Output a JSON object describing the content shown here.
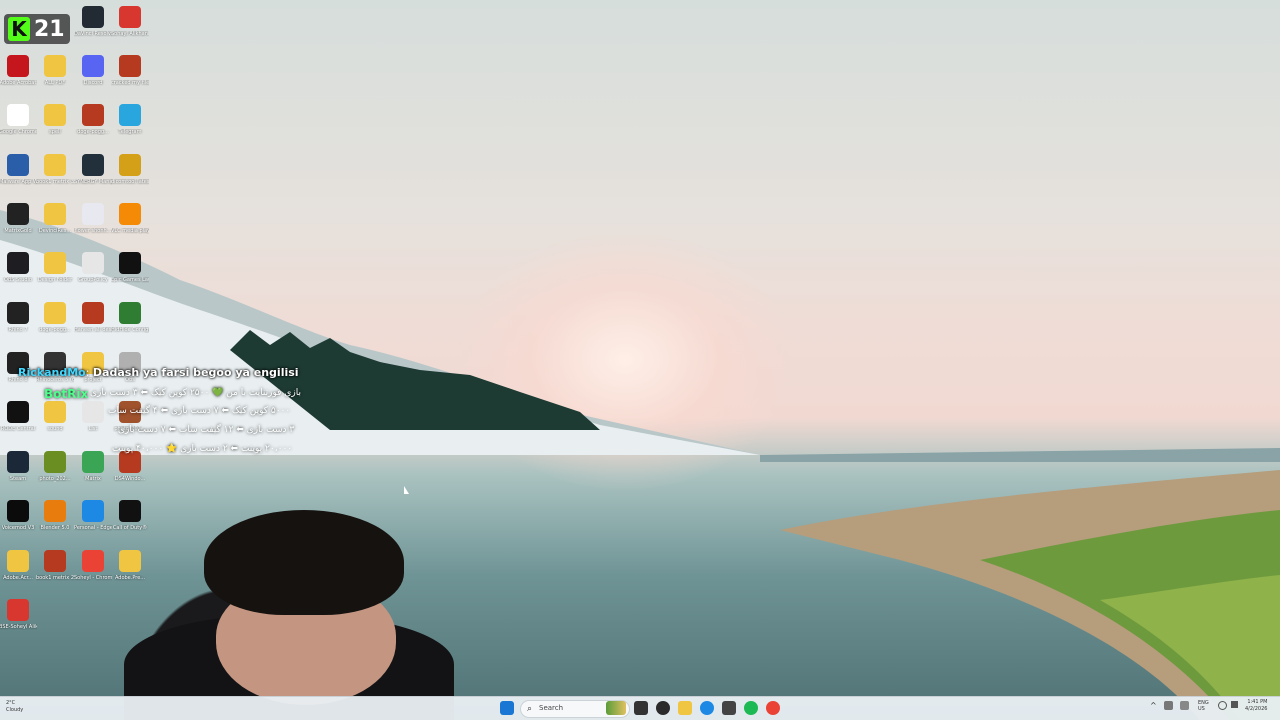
{
  "overlay": {
    "kick_count": "21"
  },
  "chat": {
    "user": "RickandMo",
    "message": "Dadash ya farsi begoo ya engilisi",
    "bot": "BotRix",
    "line1": "بازی فورتنایت با من 💚 ۲۵۰۰ کوین کیک ⬅ ۳ دست بازی",
    "line2": "۵۰۰۰ کوین کیک ⬅ ۷ دست بازی ⬅ ۴ گیفت ساب",
    "line3": "۳ دست بازی ⬅ ۱۲ گیفت ساب ⬅ ۷ دست بازی",
    "line4": "۲۰،۰۰۰ پوینت ⬅ ۲ دست بازی ⭐ ۴۰،۰۰۰ پوینت"
  },
  "desktop_icons": [
    {
      "label": "DaVinci Resolve",
      "color": "#222a33"
    },
    {
      "label": "Sohayl Alikhani (1)...",
      "color": "#d8372f"
    },
    {
      "label": "Adobe Acrobat",
      "color": "#c4161c"
    },
    {
      "label": "ALL PDF",
      "color": "#f0c542"
    },
    {
      "label": "Discord",
      "color": "#5865f2"
    },
    {
      "label": "cracked my files",
      "color": "#b53a1f"
    },
    {
      "label": "Google Chrome",
      "color": "#ffffff"
    },
    {
      "label": "spell",
      "color": "#f0c542"
    },
    {
      "label": "doge-pogg...",
      "color": "#b53a1f"
    },
    {
      "label": "Telegram",
      "color": "#2aa6de"
    },
    {
      "label": "Malware App Windows P...",
      "color": "#2a5ea8"
    },
    {
      "label": "book1 metrix 3",
      "color": "#f0c542"
    },
    {
      "label": "SYNERGY Manager",
      "color": "#22303c"
    },
    {
      "label": "dicomtool latest",
      "color": "#d4a017"
    },
    {
      "label": "MatrixGold",
      "color": "#222222"
    },
    {
      "label": "DevinciRes...",
      "color": "#f0c542"
    },
    {
      "label": "flower shonh...",
      "color": "#e8e8f0"
    },
    {
      "label": "VLC media player",
      "color": "#f58a07"
    },
    {
      "label": "OBS Studio",
      "color": "#1e1e22"
    },
    {
      "label": "Design Folder",
      "color": "#f0c542"
    },
    {
      "label": "GroupPolicy",
      "color": "#e6e6e6"
    },
    {
      "label": "Epic Games Launcher",
      "color": "#111111"
    },
    {
      "label": "Rhino 7",
      "color": "#222222"
    },
    {
      "label": "doge-pogg...",
      "color": "#f0c542"
    },
    {
      "label": "Haneen all designs ...",
      "color": "#b53a1f"
    },
    {
      "label": "HidHide Configurat...",
      "color": "#2e7d32"
    },
    {
      "label": "Rhino 8",
      "color": "#222222"
    },
    {
      "label": "Rhinoceros 5 (64-bit)",
      "color": "#333333"
    },
    {
      "label": "project",
      "color": "#f0c542"
    },
    {
      "label": "Obs",
      "color": "#b0b0b0"
    },
    {
      "label": "RODE Central",
      "color": "#111111"
    },
    {
      "label": "sound",
      "color": "#f0c542"
    },
    {
      "label": "List",
      "color": "#e6e6e6"
    },
    {
      "label": "photo_202...",
      "color": "#a0522d"
    },
    {
      "label": "Steam",
      "color": "#1b2838"
    },
    {
      "label": "photo_202...",
      "color": "#6b8e23"
    },
    {
      "label": "Matrix",
      "color": "#3aa655"
    },
    {
      "label": "DS4Windo...",
      "color": "#b53a1f"
    },
    {
      "label": "Voicemod V3",
      "color": "#0b0b0b"
    },
    {
      "label": "Blender 5.0",
      "color": "#e87d0d"
    },
    {
      "label": "Personal - Edge",
      "color": "#1e88e5"
    },
    {
      "label": "Call of Duty®",
      "color": "#111111"
    },
    {
      "label": "Adobe.Acr...",
      "color": "#f0c542"
    },
    {
      "label": "book1 metrix 2",
      "color": "#b53a1f"
    },
    {
      "label": "Soheyl - Chrome",
      "color": "#ea4335"
    },
    {
      "label": "Adobe.Pre...",
      "color": "#f0c542"
    },
    {
      "label": "BSE-Soheyl Alikhani...",
      "color": "#d8372f"
    }
  ],
  "taskbar": {
    "search_placeholder": "Search",
    "weather_temp": "2°C",
    "weather_desc": "Cloudy",
    "lang": "ENG",
    "region": "US",
    "time": "1:41 PM",
    "date": "4/2/2026"
  }
}
